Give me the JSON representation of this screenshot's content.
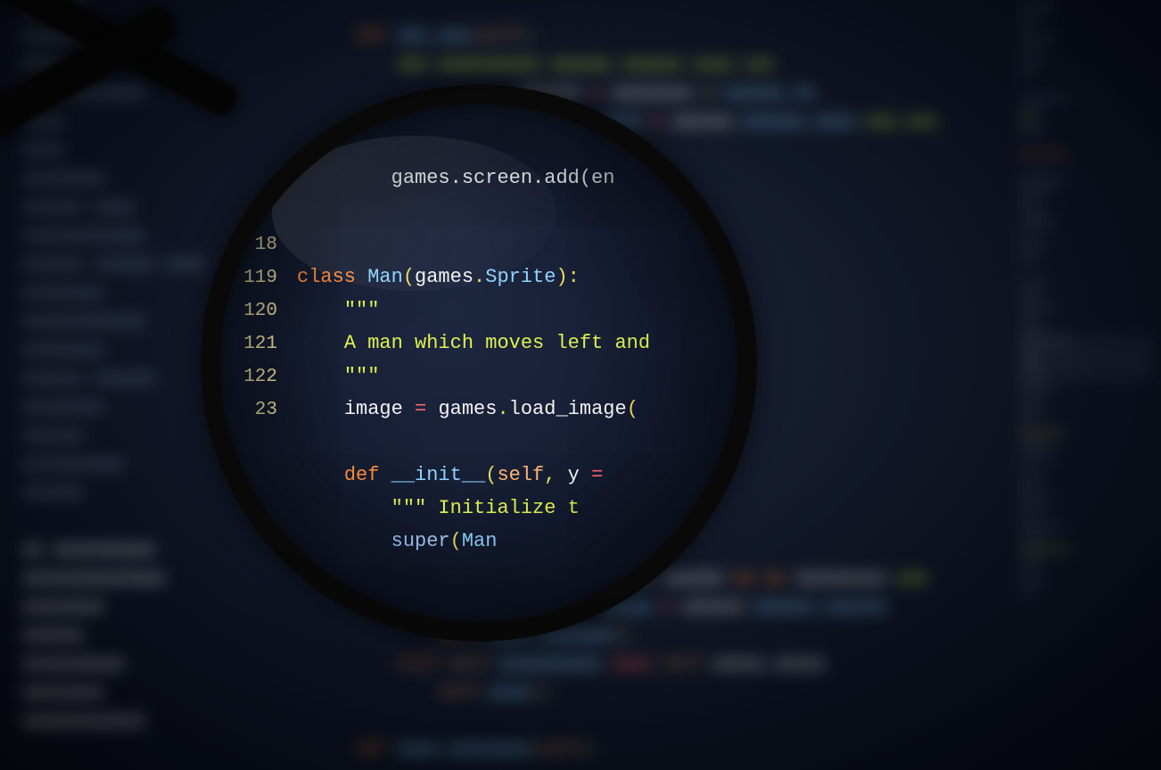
{
  "lens_code": {
    "line_prelude": "games.screen.add(en",
    "ln_18": "18",
    "ln_119": "119",
    "ln_120": "120",
    "ln_121": "121",
    "ln_122": "122",
    "ln_123": "23",
    "row_119_kw": "class ",
    "row_119_ty": "Man",
    "row_119_p1": "(",
    "row_119_mod": "games",
    "row_119_dot": ".",
    "row_119_ty2": "Sprite",
    "row_119_p2": ")",
    "row_119_colon": ":",
    "row_120_doc": "\"\"\"",
    "row_121_doc": "A man which moves left and",
    "row_122_doc": "\"\"\"",
    "row_123_lhs": "image ",
    "row_123_eq": "= ",
    "row_123_rhs": "games",
    "row_123_dot": ".",
    "row_123_fn": "load_image",
    "row_123_p1": "(",
    "row_def_kw": "def ",
    "row_def_name": "__init__",
    "row_def_p1": "(",
    "row_def_self": "self",
    "row_def_comma": ", ",
    "row_def_arg": "y ",
    "row_def_eq": "=",
    "row_init_doc": "\"\"\" Initialize t",
    "row_super_fn": "super",
    "row_super_p1": "(",
    "row_super_arg": "Man"
  }
}
